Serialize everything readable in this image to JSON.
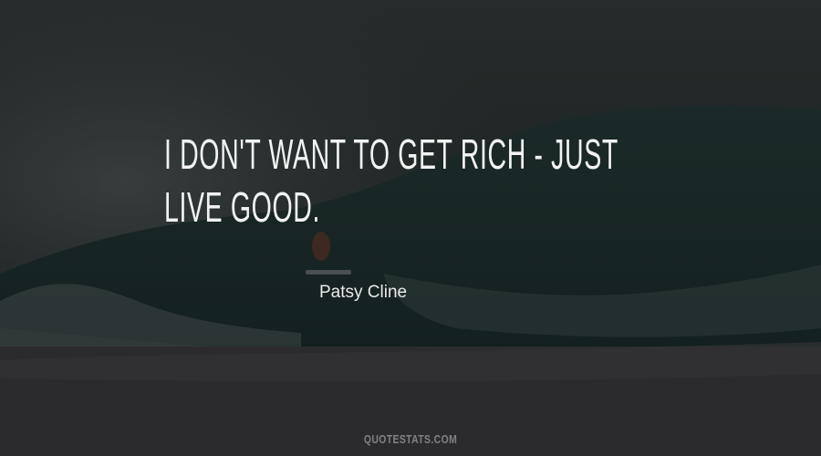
{
  "quote": {
    "text": "I don't want to get rich - just live good.",
    "display": "I DON'T WANT TO GET RICH - JUST LIVE GOOD."
  },
  "author": {
    "name": "Patsy Cline"
  },
  "watermark": {
    "text": "QUOTESTATS.COM"
  }
}
